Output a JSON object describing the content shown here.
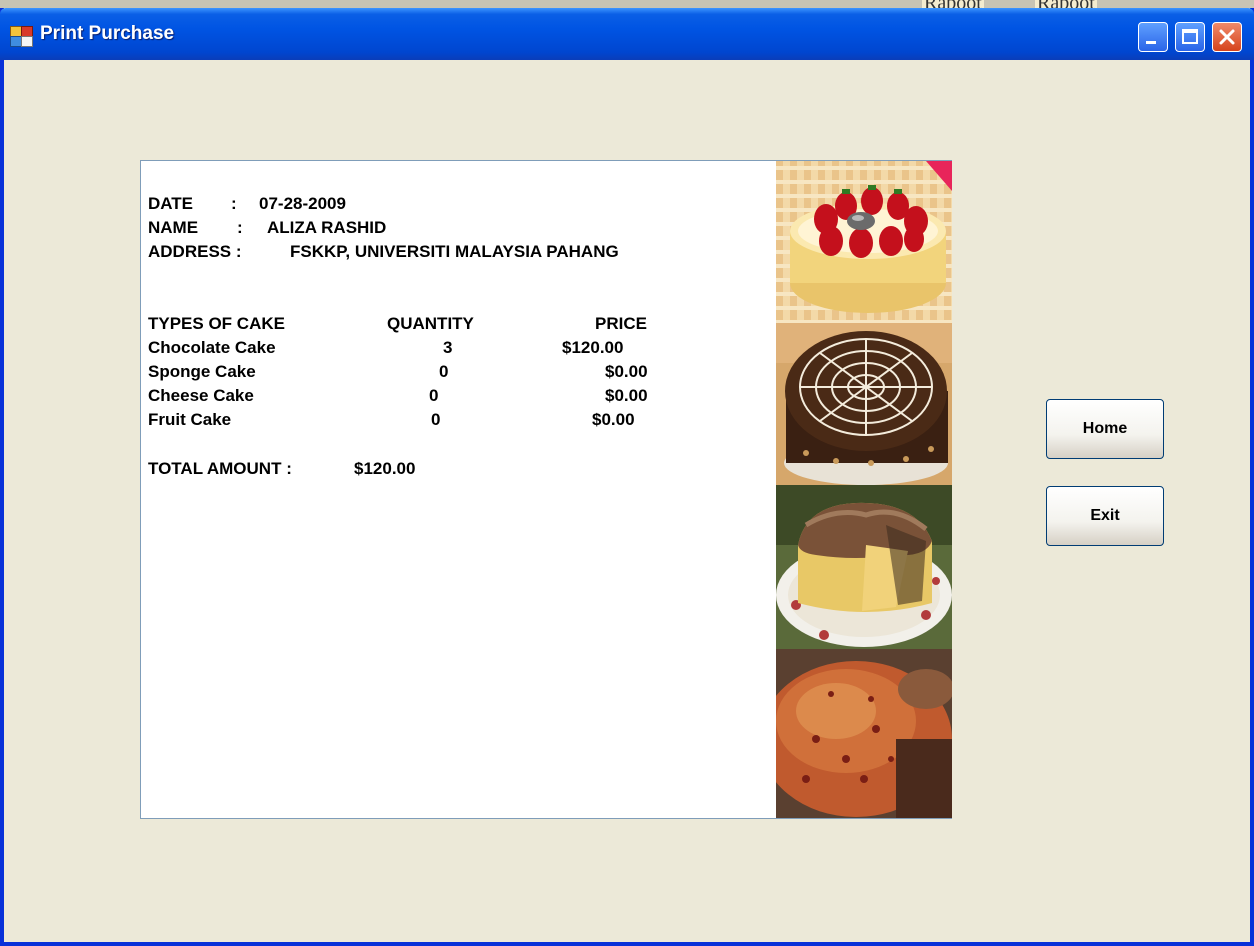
{
  "window": {
    "title": "Print Purchase"
  },
  "background_tabs": [
    "Raboot",
    "Raboot"
  ],
  "receipt": {
    "date_label": "DATE",
    "date_sep": ":",
    "date_value": "07-28-2009",
    "name_label": "NAME",
    "name_sep": ":",
    "name_value": "ALIZA RASHID",
    "address_label": "ADDRESS :",
    "address_value": "FSKKP, UNIVERSITI MALAYSIA PAHANG",
    "headers": {
      "type": "TYPES OF CAKE",
      "quantity": "QUANTITY",
      "price": "PRICE"
    },
    "items": [
      {
        "type": "Chocolate Cake",
        "quantity": "3",
        "price": "$120.00"
      },
      {
        "type": "Sponge Cake",
        "quantity": "0",
        "price": "$0.00"
      },
      {
        "type": "Cheese Cake",
        "quantity": "0",
        "price": "$0.00"
      },
      {
        "type": "Fruit Cake",
        "quantity": "0",
        "price": "$0.00"
      }
    ],
    "total_label": "TOTAL AMOUNT :",
    "total_value": "$120.00"
  },
  "cake_images": [
    {
      "icon": "strawberry-cake-photo"
    },
    {
      "icon": "chocolate-cake-photo"
    },
    {
      "icon": "chiffon-cake-photo"
    },
    {
      "icon": "fruit-cake-photo"
    }
  ],
  "buttons": {
    "home": "Home",
    "exit": "Exit"
  },
  "colors": {
    "titlebar": "#0054e3",
    "window_bg": "#ECE9D8",
    "panel_bg": "#ffffff",
    "close_button": "#d6431c"
  }
}
